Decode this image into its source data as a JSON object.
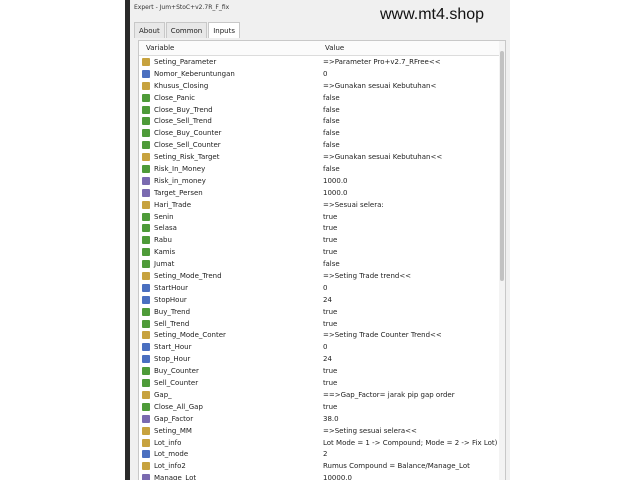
{
  "window": {
    "title": "Expert - Jum+StoC+v2.7R_F_fix"
  },
  "watermark": "www.mt4.shop",
  "tabs": [
    {
      "label": "About"
    },
    {
      "label": "Common"
    },
    {
      "label": "Inputs"
    }
  ],
  "table": {
    "headers": {
      "variable": "Variable",
      "value": "Value"
    },
    "rows": [
      {
        "name": "Seting_Parameter",
        "value": "=>Parameter Pro+v2.7_RFree<<",
        "type": "str"
      },
      {
        "name": "Nomor_Keberuntungan",
        "value": "0",
        "type": "int"
      },
      {
        "name": "Khusus_Closing",
        "value": "=>Gunakan sesuai Kebutuhan<",
        "type": "str"
      },
      {
        "name": "Close_Panic",
        "value": "false",
        "type": "bool"
      },
      {
        "name": "Close_Buy_Trend",
        "value": "false",
        "type": "bool"
      },
      {
        "name": "Close_Sell_Trend",
        "value": "false",
        "type": "bool"
      },
      {
        "name": "Close_Buy_Counter",
        "value": "false",
        "type": "bool"
      },
      {
        "name": "Close_Sell_Counter",
        "value": "false",
        "type": "bool"
      },
      {
        "name": "Seting_Risk_Target",
        "value": "=>Gunakan sesuai Kebutuhan<<",
        "type": "str"
      },
      {
        "name": "Risk_In_Money",
        "value": "false",
        "type": "bool"
      },
      {
        "name": "Risk_in_money",
        "value": "1000.0",
        "type": "dbl"
      },
      {
        "name": "Target_Persen",
        "value": "1000.0",
        "type": "dbl"
      },
      {
        "name": "Hari_Trade",
        "value": "=>Sesuai selera:",
        "type": "str"
      },
      {
        "name": "Senin",
        "value": "true",
        "type": "bool"
      },
      {
        "name": "Selasa",
        "value": "true",
        "type": "bool"
      },
      {
        "name": "Rabu",
        "value": "true",
        "type": "bool"
      },
      {
        "name": "Kamis",
        "value": "true",
        "type": "bool"
      },
      {
        "name": "Jumat",
        "value": "false",
        "type": "bool"
      },
      {
        "name": "Seting_Mode_Trend",
        "value": "=>Seting Trade trend<<",
        "type": "str"
      },
      {
        "name": "StartHour",
        "value": "0",
        "type": "int"
      },
      {
        "name": "StopHour",
        "value": "24",
        "type": "int"
      },
      {
        "name": "Buy_Trend",
        "value": "true",
        "type": "bool"
      },
      {
        "name": "Sell_Trend",
        "value": "true",
        "type": "bool"
      },
      {
        "name": "Seting_Mode_Conter",
        "value": "=>Seting Trade Counter Trend<<",
        "type": "str"
      },
      {
        "name": "Start_Hour",
        "value": "0",
        "type": "int"
      },
      {
        "name": "Stop_Hour",
        "value": "24",
        "type": "int"
      },
      {
        "name": "Buy_Counter",
        "value": "true",
        "type": "bool"
      },
      {
        "name": "Sell_Counter",
        "value": "true",
        "type": "bool"
      },
      {
        "name": "Gap_",
        "value": "==>Gap_Factor= jarak pip gap order",
        "type": "str"
      },
      {
        "name": "Close_All_Gap",
        "value": "true",
        "type": "bool"
      },
      {
        "name": "Gap_Factor",
        "value": "38.0",
        "type": "dbl"
      },
      {
        "name": "Seting_MM",
        "value": "=>Seting sesuai selera<<",
        "type": "str"
      },
      {
        "name": "Lot_info",
        "value": "Lot Mode = 1 -> Compound; Mode = 2 -> Fix Lot)",
        "type": "str"
      },
      {
        "name": "Lot_mode",
        "value": "2",
        "type": "int"
      },
      {
        "name": "Lot_info2",
        "value": "Rumus Compound = Balance/Manage_Lot",
        "type": "str"
      },
      {
        "name": "Manage_Lot",
        "value": "10000.0",
        "type": "dbl"
      }
    ]
  }
}
